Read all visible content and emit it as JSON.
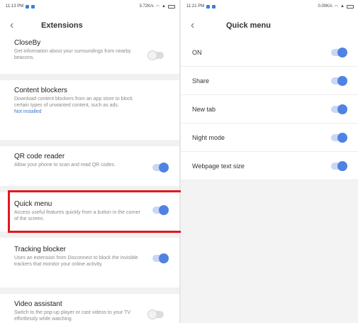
{
  "left": {
    "status": {
      "time": "11:13 PM",
      "right": "3.72K/s"
    },
    "title": "Extensions",
    "items": [
      {
        "name": "CloseBy",
        "desc": "Get information about your surroundings from nearby beacons.",
        "toggle": "off"
      },
      {
        "name": "Content blockers",
        "desc": "Download content blockers from an app store to block certain types of unwanted content, such as ads.",
        "link": "Not installed"
      },
      {
        "name": "QR code reader",
        "desc": "Allow your phone to scan and read QR codes.",
        "toggle": "on"
      },
      {
        "name": "Quick menu",
        "desc": "Access useful features quickly from a button in the corner of the screen.",
        "toggle": "on"
      },
      {
        "name": "Tracking blocker",
        "desc": "Uses an extension from Disconnect to block the invisible trackers that monitor your online activity.",
        "toggle": "on"
      },
      {
        "name": "Video assistant",
        "desc": "Switch to the pop-up player or cast videos to your TV effortlessly while watching",
        "toggle": "off"
      }
    ]
  },
  "right": {
    "status": {
      "time": "11:21 PM",
      "right": "0.00K/s"
    },
    "title": "Quick menu",
    "rows": [
      {
        "label": "ON",
        "toggle": "on"
      },
      {
        "label": "Share",
        "toggle": "on"
      },
      {
        "label": "New tab",
        "toggle": "on"
      },
      {
        "label": "Night mode",
        "toggle": "on"
      },
      {
        "label": "Webpage text size",
        "toggle": "on"
      }
    ]
  },
  "colors": {
    "accent": "#4f83e3",
    "highlight": "#e0181f",
    "link": "#3d74d6"
  }
}
